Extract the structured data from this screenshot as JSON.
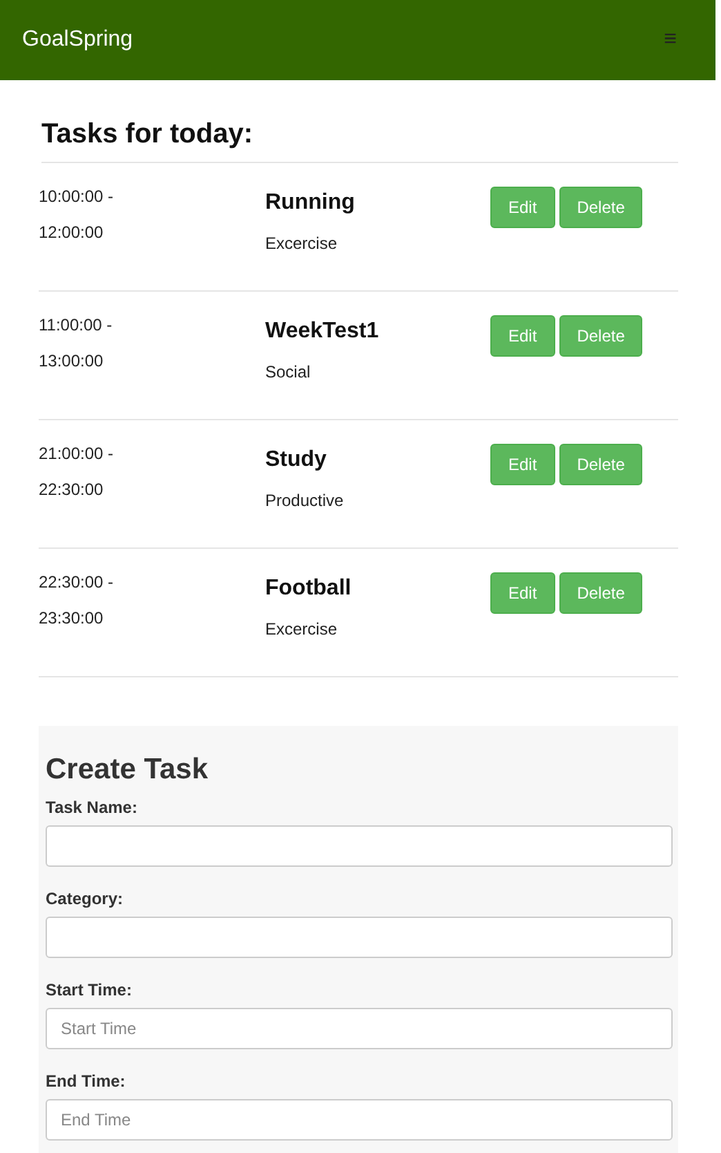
{
  "navbar": {
    "brand": "GoalSpring",
    "menu_icon": "≡"
  },
  "tasks_heading": "Tasks for today:",
  "tasks": [
    {
      "start": "10:00:00 -",
      "end": "12:00:00",
      "name": "Running",
      "category": "Excercise",
      "actions": [
        "Edit",
        "Delete"
      ]
    },
    {
      "start": "11:00:00 -",
      "end": "13:00:00",
      "name": "WeekTest1",
      "category": "Social",
      "actions": [
        "Edit",
        "Delete"
      ]
    },
    {
      "start": "21:00:00 -",
      "end": "22:30:00",
      "name": "Study",
      "category": "Productive",
      "actions": [
        "Edit",
        "Delete"
      ]
    },
    {
      "start": "22:30:00 -",
      "end": "23:30:00",
      "name": "Football",
      "category": "Excercise",
      "actions": [
        "Edit",
        "Delete"
      ]
    }
  ],
  "create_form": {
    "title": "Create Task",
    "fields": [
      {
        "label": "Task Name:"
      },
      {
        "label": "Category:"
      },
      {
        "label": "Start Time:",
        "placeholder": "Start Time"
      },
      {
        "label": "End Time:",
        "placeholder": "End Time"
      }
    ]
  }
}
